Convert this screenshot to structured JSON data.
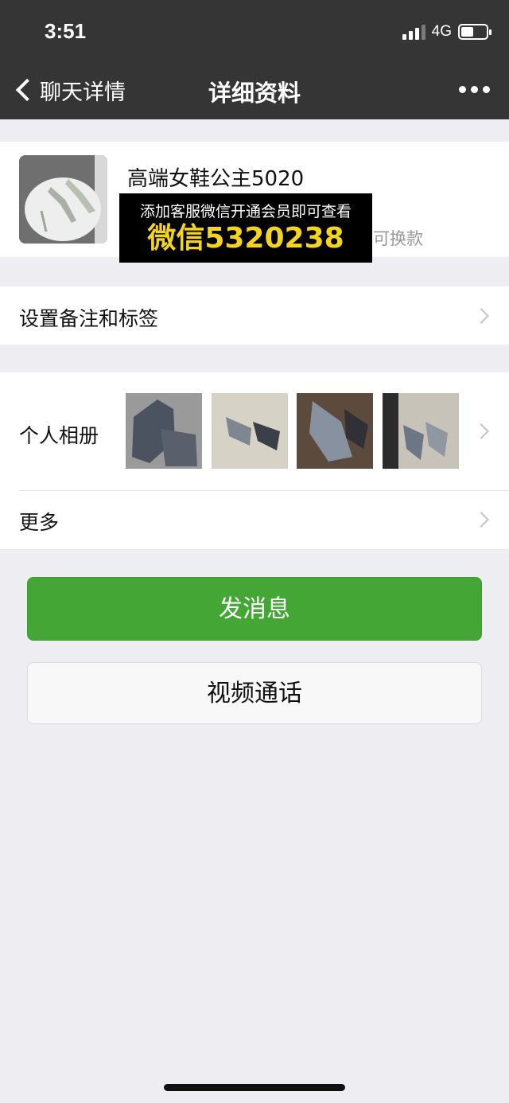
{
  "status": {
    "time": "3:51",
    "network": "4G"
  },
  "nav": {
    "back_label": "聊天详情",
    "title": "详细资料"
  },
  "profile": {
    "name": "高端女鞋公主5020",
    "subtitle": "档可换款",
    "overlay_line1": "添加客服微信开通会员即可查看",
    "overlay_line2": "微信5320238"
  },
  "rows": {
    "remark": "设置备注和标签",
    "album": "个人相册",
    "more": "更多"
  },
  "buttons": {
    "send": "发消息",
    "video": "视频通话"
  },
  "colors": {
    "topbar": "#353535",
    "accent": "#43a635",
    "overlay_text": "#f5d51c"
  },
  "icons": [
    "back-chevron-icon",
    "more-dots-icon",
    "chevron-right-icon",
    "signal-icon",
    "battery-icon"
  ]
}
